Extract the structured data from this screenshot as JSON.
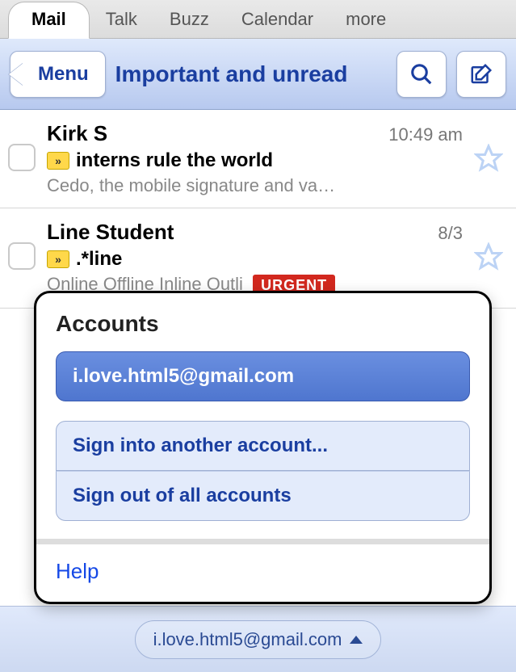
{
  "tabs": {
    "active": "Mail",
    "items": [
      "Mail",
      "Talk",
      "Buzz",
      "Calendar",
      "more"
    ]
  },
  "toolbar": {
    "menu_label": "Menu",
    "title": "Important and unread"
  },
  "emails": [
    {
      "sender": "Kirk S",
      "time": "10:49 am",
      "subject": "interns rule the world",
      "preview": "Cedo, the mobile signature and va…",
      "important": true,
      "urgent": false
    },
    {
      "sender": "Line Student",
      "time": "8/3",
      "subject": ".*line",
      "preview": "Online Offline Inline Outli",
      "important": true,
      "urgent": true,
      "urgent_label": "URGENT"
    }
  ],
  "popup": {
    "title": "Accounts",
    "selected_account": "i.love.html5@gmail.com",
    "sign_in_label": "Sign into another account...",
    "sign_out_label": "Sign out of all accounts",
    "help_label": "Help"
  },
  "footer": {
    "account": "i.love.html5@gmail.com"
  }
}
